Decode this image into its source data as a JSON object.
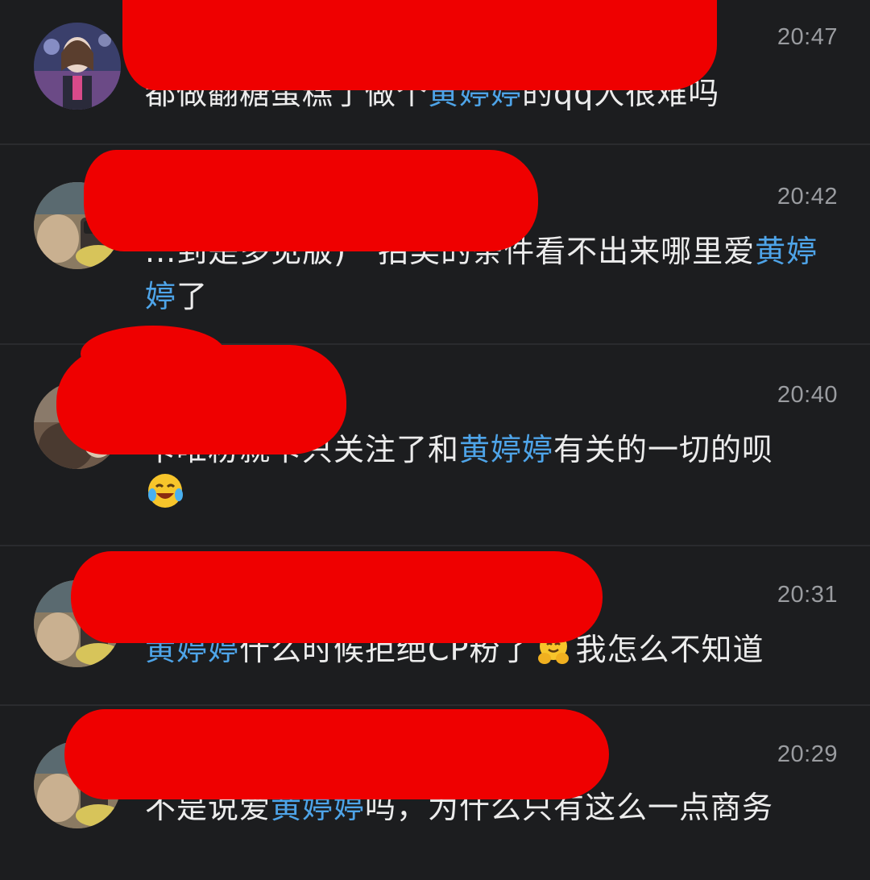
{
  "messages": [
    {
      "time": "20:47",
      "parts": [
        {
          "t": "都做翻糖蛋糕了做个",
          "hl": false
        },
        {
          "t": "黄婷婷",
          "hl": true
        },
        {
          "t": "的qq人很难吗",
          "hl": false
        }
      ],
      "emoji": ""
    },
    {
      "time": "20:42",
      "parts": [
        {
          "t": "...到是多见版)　拍美的条件看不出来哪里爱",
          "hl": false
        },
        {
          "t": "黄婷婷",
          "hl": true
        },
        {
          "t": "了",
          "hl": false
        }
      ],
      "emoji": ""
    },
    {
      "time": "20:40",
      "parts": [
        {
          "t": "卡唯粉就卡只关注了和",
          "hl": false
        },
        {
          "t": "黄婷婷",
          "hl": true
        },
        {
          "t": "有关的一切的呗",
          "hl": false
        }
      ],
      "emoji": "laughing-tears-emoji"
    },
    {
      "time": "20:31",
      "parts": [
        {
          "t": "黄婷婷",
          "hl": true
        },
        {
          "t": "什么时候拒绝CP粉了",
          "hl": false
        },
        {
          "t": "[hug]",
          "hl": false
        },
        {
          "t": "我怎么不知道",
          "hl": false
        }
      ],
      "emoji": "hugging-emoji"
    },
    {
      "time": "20:29",
      "parts": [
        {
          "t": "不是说爱",
          "hl": false
        },
        {
          "t": "黄婷婷",
          "hl": true
        },
        {
          "t": "吗，为什么只有这么一点商务",
          "hl": false
        }
      ],
      "emoji": ""
    }
  ],
  "colors": {
    "background": "#1c1d1f",
    "highlight": "#4ea4e8",
    "redaction": "#ef0000",
    "timestamp": "#9a9ca0"
  }
}
